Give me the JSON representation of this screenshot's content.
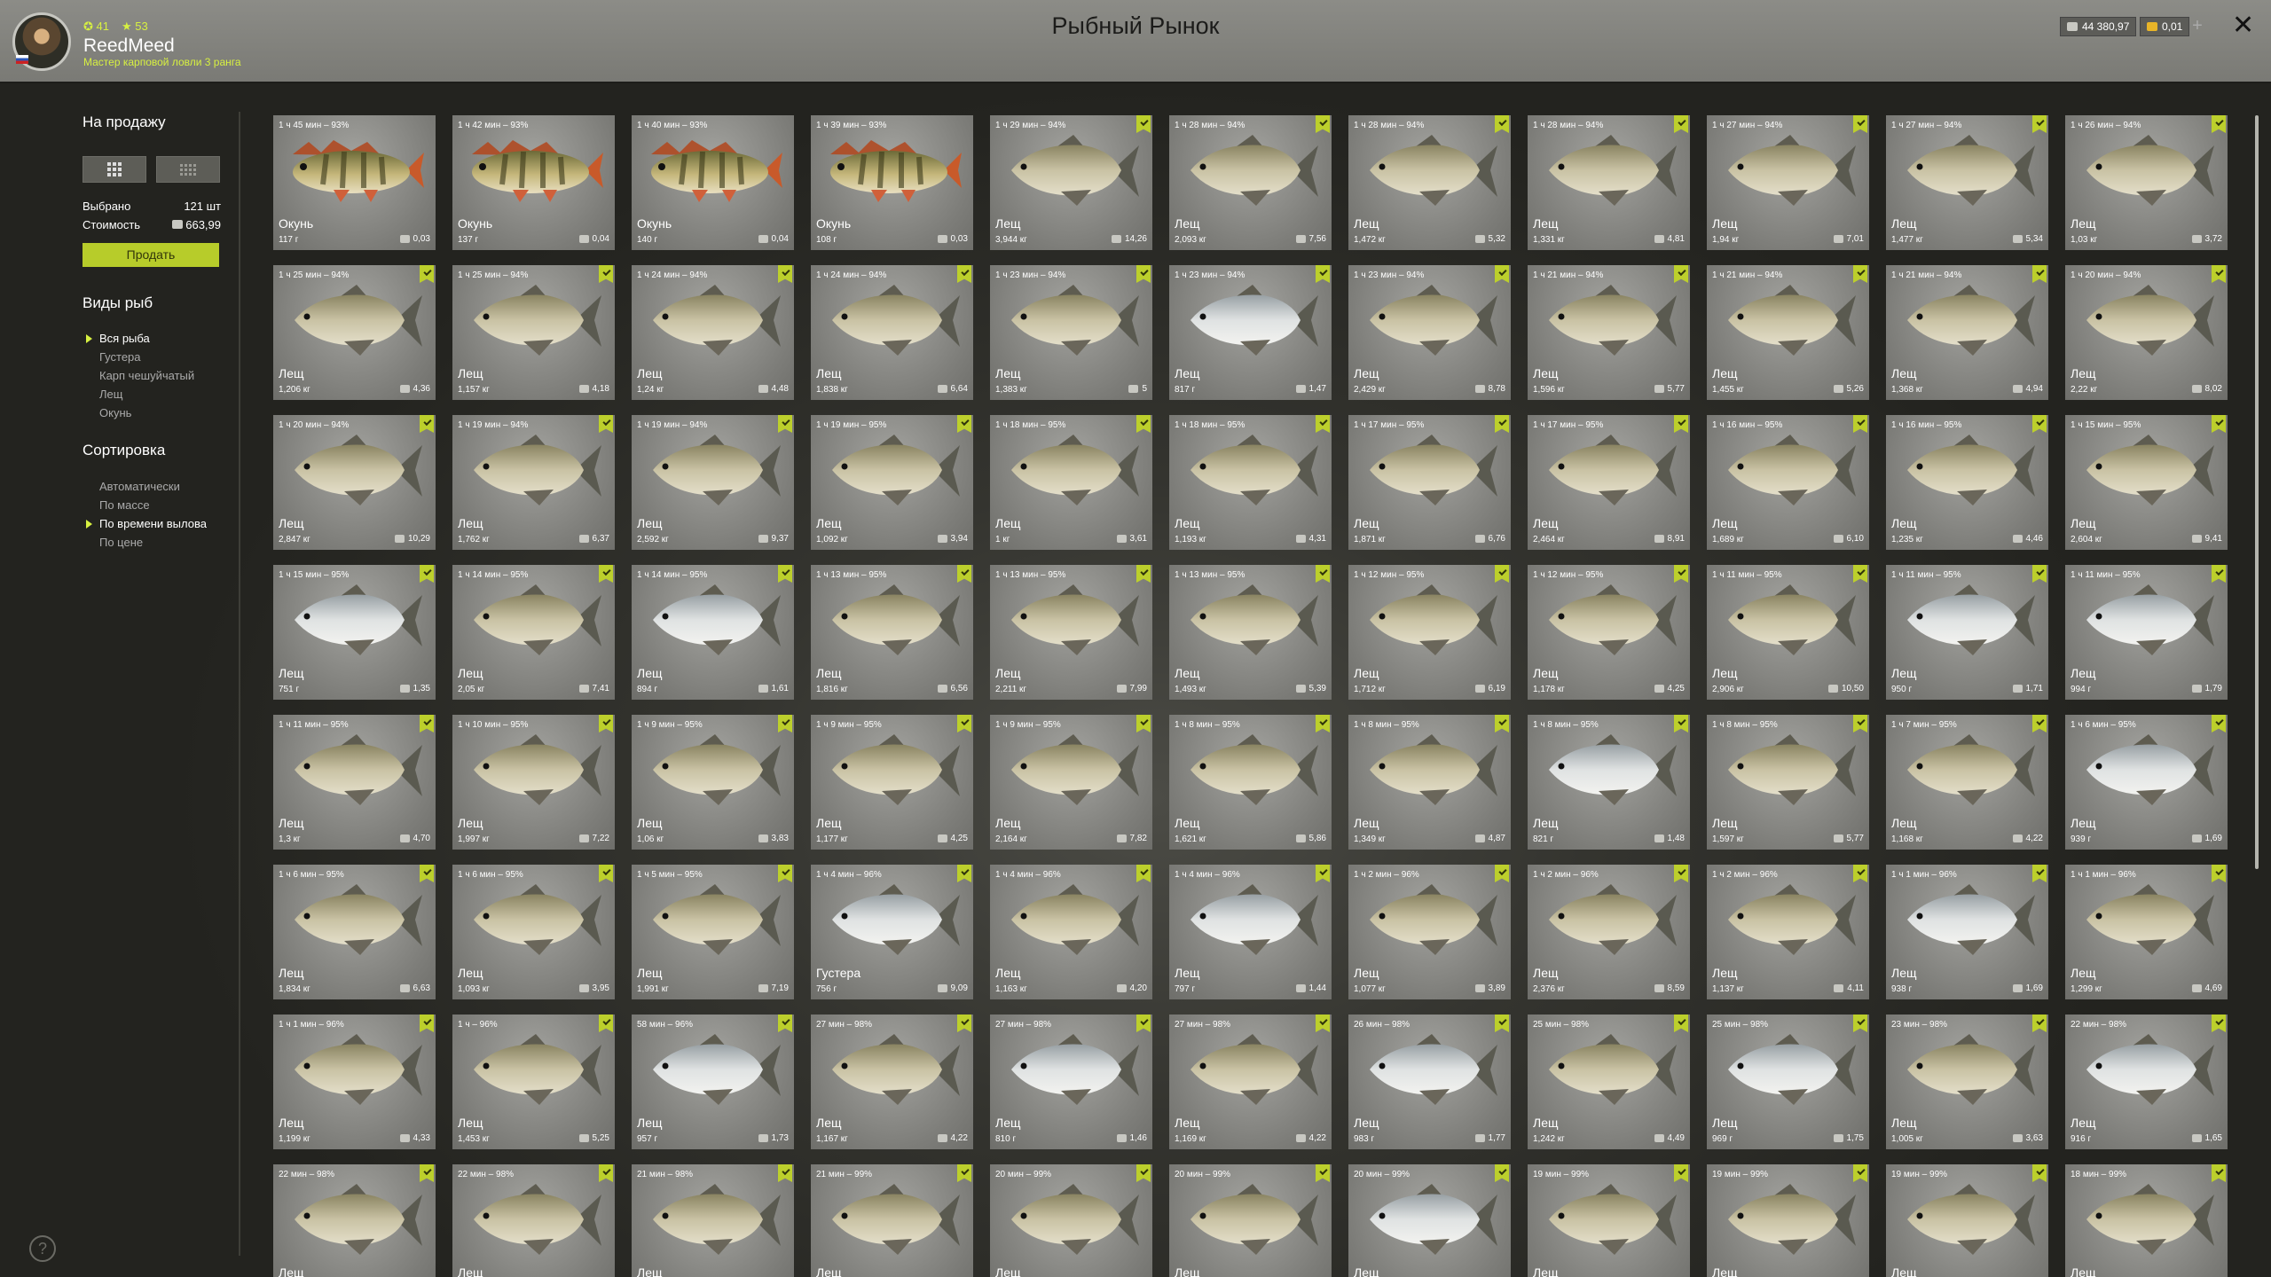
{
  "header": {
    "title": "Рыбный Рынок",
    "level": "41",
    "stars": "53",
    "username": "ReedMeed",
    "rank": "Мастер карповой ловли 3 ранга",
    "silver": "44 380,97",
    "gold": "0,01",
    "add_label": "+",
    "close_label": "✕"
  },
  "sidebar": {
    "sale_heading": "На продажу",
    "selected_label": "Выбрано",
    "selected_value": "121 шт",
    "cost_label": "Стоимость",
    "cost_value": "663,99",
    "sell_button": "Продать",
    "species_heading": "Виды рыб",
    "species": [
      "Вся рыба",
      "Густера",
      "Карп чешуйчатый",
      "Лещ",
      "Окунь"
    ],
    "sort_heading": "Сортировка",
    "sort": [
      "Автоматически",
      "По массе",
      "По времени вылова",
      "По цене"
    ],
    "help": "?"
  },
  "fish": [
    {
      "t": "1 ч 45 мин – 93%",
      "n": "Окунь",
      "w": "117 г",
      "p": "0,03",
      "k": "perch",
      "m": false
    },
    {
      "t": "1 ч 42 мин – 93%",
      "n": "Окунь",
      "w": "137 г",
      "p": "0,04",
      "k": "perch",
      "m": false
    },
    {
      "t": "1 ч 40 мин – 93%",
      "n": "Окунь",
      "w": "140 г",
      "p": "0,04",
      "k": "perch",
      "m": false
    },
    {
      "t": "1 ч 39 мин – 93%",
      "n": "Окунь",
      "w": "108 г",
      "p": "0,03",
      "k": "perch",
      "m": false
    },
    {
      "t": "1 ч 29 мин – 94%",
      "n": "Лещ",
      "w": "3,944 кг",
      "p": "14,26",
      "k": "bream",
      "m": true
    },
    {
      "t": "1 ч 28 мин – 94%",
      "n": "Лещ",
      "w": "2,093 кг",
      "p": "7,56",
      "k": "bream",
      "m": true
    },
    {
      "t": "1 ч 28 мин – 94%",
      "n": "Лещ",
      "w": "1,472 кг",
      "p": "5,32",
      "k": "bream",
      "m": true
    },
    {
      "t": "1 ч 28 мин – 94%",
      "n": "Лещ",
      "w": "1,331 кг",
      "p": "4,81",
      "k": "bream",
      "m": true
    },
    {
      "t": "1 ч 27 мин – 94%",
      "n": "Лещ",
      "w": "1,94 кг",
      "p": "7,01",
      "k": "bream",
      "m": true
    },
    {
      "t": "1 ч 27 мин – 94%",
      "n": "Лещ",
      "w": "1,477 кг",
      "p": "5,34",
      "k": "bream",
      "m": true
    },
    {
      "t": "1 ч 26 мин – 94%",
      "n": "Лещ",
      "w": "1,03 кг",
      "p": "3,72",
      "k": "bream",
      "m": true
    },
    {
      "t": "1 ч 25 мин – 94%",
      "n": "Лещ",
      "w": "1,206 кг",
      "p": "4,36",
      "k": "bream",
      "m": true
    },
    {
      "t": "1 ч 25 мин – 94%",
      "n": "Лещ",
      "w": "1,157 кг",
      "p": "4,18",
      "k": "bream",
      "m": true
    },
    {
      "t": "1 ч 24 мин – 94%",
      "n": "Лещ",
      "w": "1,24 кг",
      "p": "4,48",
      "k": "bream",
      "m": true
    },
    {
      "t": "1 ч 24 мин – 94%",
      "n": "Лещ",
      "w": "1,838 кг",
      "p": "6,64",
      "k": "bream",
      "m": true
    },
    {
      "t": "1 ч 23 мин – 94%",
      "n": "Лещ",
      "w": "1,383 кг",
      "p": "5",
      "k": "bream",
      "m": true
    },
    {
      "t": "1 ч 23 мин – 94%",
      "n": "Лещ",
      "w": "817 г",
      "p": "1,47",
      "k": "silver",
      "m": true
    },
    {
      "t": "1 ч 23 мин – 94%",
      "n": "Лещ",
      "w": "2,429 кг",
      "p": "8,78",
      "k": "bream",
      "m": true
    },
    {
      "t": "1 ч 21 мин – 94%",
      "n": "Лещ",
      "w": "1,596 кг",
      "p": "5,77",
      "k": "bream",
      "m": true
    },
    {
      "t": "1 ч 21 мин – 94%",
      "n": "Лещ",
      "w": "1,455 кг",
      "p": "5,26",
      "k": "bream",
      "m": true
    },
    {
      "t": "1 ч 21 мин – 94%",
      "n": "Лещ",
      "w": "1,368 кг",
      "p": "4,94",
      "k": "bream",
      "m": true
    },
    {
      "t": "1 ч 20 мин – 94%",
      "n": "Лещ",
      "w": "2,22 кг",
      "p": "8,02",
      "k": "bream",
      "m": true
    },
    {
      "t": "1 ч 20 мин – 94%",
      "n": "Лещ",
      "w": "2,847 кг",
      "p": "10,29",
      "k": "bream",
      "m": true
    },
    {
      "t": "1 ч 19 мин – 94%",
      "n": "Лещ",
      "w": "1,762 кг",
      "p": "6,37",
      "k": "bream",
      "m": true
    },
    {
      "t": "1 ч 19 мин – 94%",
      "n": "Лещ",
      "w": "2,592 кг",
      "p": "9,37",
      "k": "bream",
      "m": true
    },
    {
      "t": "1 ч 19 мин – 95%",
      "n": "Лещ",
      "w": "1,092 кг",
      "p": "3,94",
      "k": "bream",
      "m": true
    },
    {
      "t": "1 ч 18 мин – 95%",
      "n": "Лещ",
      "w": "1 кг",
      "p": "3,61",
      "k": "bream",
      "m": true
    },
    {
      "t": "1 ч 18 мин – 95%",
      "n": "Лещ",
      "w": "1,193 кг",
      "p": "4,31",
      "k": "bream",
      "m": true
    },
    {
      "t": "1 ч 17 мин – 95%",
      "n": "Лещ",
      "w": "1,871 кг",
      "p": "6,76",
      "k": "bream",
      "m": true
    },
    {
      "t": "1 ч 17 мин – 95%",
      "n": "Лещ",
      "w": "2,464 кг",
      "p": "8,91",
      "k": "bream",
      "m": true
    },
    {
      "t": "1 ч 16 мин – 95%",
      "n": "Лещ",
      "w": "1,689 кг",
      "p": "6,10",
      "k": "bream",
      "m": true
    },
    {
      "t": "1 ч 16 мин – 95%",
      "n": "Лещ",
      "w": "1,235 кг",
      "p": "4,46",
      "k": "bream",
      "m": true
    },
    {
      "t": "1 ч 15 мин – 95%",
      "n": "Лещ",
      "w": "2,604 кг",
      "p": "9,41",
      "k": "bream",
      "m": true
    },
    {
      "t": "1 ч 15 мин – 95%",
      "n": "Лещ",
      "w": "751 г",
      "p": "1,35",
      "k": "silver",
      "m": true
    },
    {
      "t": "1 ч 14 мин – 95%",
      "n": "Лещ",
      "w": "2,05 кг",
      "p": "7,41",
      "k": "bream",
      "m": true
    },
    {
      "t": "1 ч 14 мин – 95%",
      "n": "Лещ",
      "w": "894 г",
      "p": "1,61",
      "k": "silver",
      "m": true
    },
    {
      "t": "1 ч 13 мин – 95%",
      "n": "Лещ",
      "w": "1,816 кг",
      "p": "6,56",
      "k": "bream",
      "m": true
    },
    {
      "t": "1 ч 13 мин – 95%",
      "n": "Лещ",
      "w": "2,211 кг",
      "p": "7,99",
      "k": "bream",
      "m": true
    },
    {
      "t": "1 ч 13 мин – 95%",
      "n": "Лещ",
      "w": "1,493 кг",
      "p": "5,39",
      "k": "bream",
      "m": true
    },
    {
      "t": "1 ч 12 мин – 95%",
      "n": "Лещ",
      "w": "1,712 кг",
      "p": "6,19",
      "k": "bream",
      "m": true
    },
    {
      "t": "1 ч 12 мин – 95%",
      "n": "Лещ",
      "w": "1,178 кг",
      "p": "4,25",
      "k": "bream",
      "m": true
    },
    {
      "t": "1 ч 11 мин – 95%",
      "n": "Лещ",
      "w": "2,906 кг",
      "p": "10,50",
      "k": "bream",
      "m": true
    },
    {
      "t": "1 ч 11 мин – 95%",
      "n": "Лещ",
      "w": "950 г",
      "p": "1,71",
      "k": "silver",
      "m": true
    },
    {
      "t": "1 ч 11 мин – 95%",
      "n": "Лещ",
      "w": "994 г",
      "p": "1,79",
      "k": "silver",
      "m": true
    },
    {
      "t": "1 ч 11 мин – 95%",
      "n": "Лещ",
      "w": "1,3 кг",
      "p": "4,70",
      "k": "bream",
      "m": true
    },
    {
      "t": "1 ч 10 мин – 95%",
      "n": "Лещ",
      "w": "1,997 кг",
      "p": "7,22",
      "k": "bream",
      "m": true
    },
    {
      "t": "1 ч 9 мин – 95%",
      "n": "Лещ",
      "w": "1,06 кг",
      "p": "3,83",
      "k": "bream",
      "m": true
    },
    {
      "t": "1 ч 9 мин – 95%",
      "n": "Лещ",
      "w": "1,177 кг",
      "p": "4,25",
      "k": "bream",
      "m": true
    },
    {
      "t": "1 ч 9 мин – 95%",
      "n": "Лещ",
      "w": "2,164 кг",
      "p": "7,82",
      "k": "bream",
      "m": true
    },
    {
      "t": "1 ч 8 мин – 95%",
      "n": "Лещ",
      "w": "1,621 кг",
      "p": "5,86",
      "k": "bream",
      "m": true
    },
    {
      "t": "1 ч 8 мин – 95%",
      "n": "Лещ",
      "w": "1,349 кг",
      "p": "4,87",
      "k": "bream",
      "m": true
    },
    {
      "t": "1 ч 8 мин – 95%",
      "n": "Лещ",
      "w": "821 г",
      "p": "1,48",
      "k": "silver",
      "m": true
    },
    {
      "t": "1 ч 8 мин – 95%",
      "n": "Лещ",
      "w": "1,597 кг",
      "p": "5,77",
      "k": "bream",
      "m": true
    },
    {
      "t": "1 ч 7 мин – 95%",
      "n": "Лещ",
      "w": "1,168 кг",
      "p": "4,22",
      "k": "bream",
      "m": true
    },
    {
      "t": "1 ч 6 мин – 95%",
      "n": "Лещ",
      "w": "939 г",
      "p": "1,69",
      "k": "silver",
      "m": true
    },
    {
      "t": "1 ч 6 мин – 95%",
      "n": "Лещ",
      "w": "1,834 кг",
      "p": "6,63",
      "k": "bream",
      "m": true
    },
    {
      "t": "1 ч 6 мин – 95%",
      "n": "Лещ",
      "w": "1,093 кг",
      "p": "3,95",
      "k": "bream",
      "m": true
    },
    {
      "t": "1 ч 5 мин – 95%",
      "n": "Лещ",
      "w": "1,991 кг",
      "p": "7,19",
      "k": "bream",
      "m": true
    },
    {
      "t": "1 ч 4 мин – 96%",
      "n": "Густера",
      "w": "756 г",
      "p": "9,09",
      "k": "silver",
      "m": true
    },
    {
      "t": "1 ч 4 мин – 96%",
      "n": "Лещ",
      "w": "1,163 кг",
      "p": "4,20",
      "k": "bream",
      "m": true
    },
    {
      "t": "1 ч 4 мин – 96%",
      "n": "Лещ",
      "w": "797 г",
      "p": "1,44",
      "k": "silver",
      "m": true
    },
    {
      "t": "1 ч 2 мин – 96%",
      "n": "Лещ",
      "w": "1,077 кг",
      "p": "3,89",
      "k": "bream",
      "m": true
    },
    {
      "t": "1 ч 2 мин – 96%",
      "n": "Лещ",
      "w": "2,376 кг",
      "p": "8,59",
      "k": "bream",
      "m": true
    },
    {
      "t": "1 ч 2 мин – 96%",
      "n": "Лещ",
      "w": "1,137 кг",
      "p": "4,11",
      "k": "bream",
      "m": true
    },
    {
      "t": "1 ч 1 мин – 96%",
      "n": "Лещ",
      "w": "938 г",
      "p": "1,69",
      "k": "silver",
      "m": true
    },
    {
      "t": "1 ч 1 мин – 96%",
      "n": "Лещ",
      "w": "1,299 кг",
      "p": "4,69",
      "k": "bream",
      "m": true
    },
    {
      "t": "1 ч 1 мин – 96%",
      "n": "Лещ",
      "w": "1,199 кг",
      "p": "4,33",
      "k": "bream",
      "m": true
    },
    {
      "t": "1 ч – 96%",
      "n": "Лещ",
      "w": "1,453 кг",
      "p": "5,25",
      "k": "bream",
      "m": true
    },
    {
      "t": "58 мин – 96%",
      "n": "Лещ",
      "w": "957 г",
      "p": "1,73",
      "k": "silver",
      "m": true
    },
    {
      "t": "27 мин – 98%",
      "n": "Лещ",
      "w": "1,167 кг",
      "p": "4,22",
      "k": "bream",
      "m": true
    },
    {
      "t": "27 мин – 98%",
      "n": "Лещ",
      "w": "810 г",
      "p": "1,46",
      "k": "silver",
      "m": true
    },
    {
      "t": "27 мин – 98%",
      "n": "Лещ",
      "w": "1,169 кг",
      "p": "4,22",
      "k": "bream",
      "m": true
    },
    {
      "t": "26 мин – 98%",
      "n": "Лещ",
      "w": "983 г",
      "p": "1,77",
      "k": "silver",
      "m": true
    },
    {
      "t": "25 мин – 98%",
      "n": "Лещ",
      "w": "1,242 кг",
      "p": "4,49",
      "k": "bream",
      "m": true
    },
    {
      "t": "25 мин – 98%",
      "n": "Лещ",
      "w": "969 г",
      "p": "1,75",
      "k": "silver",
      "m": true
    },
    {
      "t": "23 мин – 98%",
      "n": "Лещ",
      "w": "1,005 кг",
      "p": "3,63",
      "k": "bream",
      "m": true
    },
    {
      "t": "22 мин – 98%",
      "n": "Лещ",
      "w": "916 г",
      "p": "1,65",
      "k": "silver",
      "m": true
    },
    {
      "t": "22 мин – 98%",
      "n": "Лещ",
      "w": "",
      "p": "",
      "k": "bream",
      "m": true
    },
    {
      "t": "22 мин – 98%",
      "n": "Лещ",
      "w": "",
      "p": "",
      "k": "bream",
      "m": true
    },
    {
      "t": "21 мин – 98%",
      "n": "Лещ",
      "w": "",
      "p": "",
      "k": "bream",
      "m": true
    },
    {
      "t": "21 мин – 99%",
      "n": "Лещ",
      "w": "",
      "p": "",
      "k": "bream",
      "m": true
    },
    {
      "t": "20 мин – 99%",
      "n": "Лещ",
      "w": "",
      "p": "",
      "k": "bream",
      "m": true
    },
    {
      "t": "20 мин – 99%",
      "n": "Лещ",
      "w": "",
      "p": "",
      "k": "bream",
      "m": true
    },
    {
      "t": "20 мин – 99%",
      "n": "Лещ",
      "w": "",
      "p": "",
      "k": "silver",
      "m": true
    },
    {
      "t": "19 мин – 99%",
      "n": "Лещ",
      "w": "",
      "p": "",
      "k": "bream",
      "m": true
    },
    {
      "t": "19 мин – 99%",
      "n": "Лещ",
      "w": "",
      "p": "",
      "k": "bream",
      "m": true
    },
    {
      "t": "19 мин – 99%",
      "n": "Лещ",
      "w": "",
      "p": "",
      "k": "bream",
      "m": true
    },
    {
      "t": "18 мин – 99%",
      "n": "Лещ",
      "w": "",
      "p": "",
      "k": "bream",
      "m": true
    }
  ],
  "colors": {
    "accent": "#d7f041",
    "bookmark": "#bccf2c",
    "sell_button": "#b7cc2a"
  },
  "icons": {
    "currency": "coin-icon",
    "bookmark": "bookmark-check-icon",
    "close": "close-icon",
    "help": "help-icon"
  }
}
